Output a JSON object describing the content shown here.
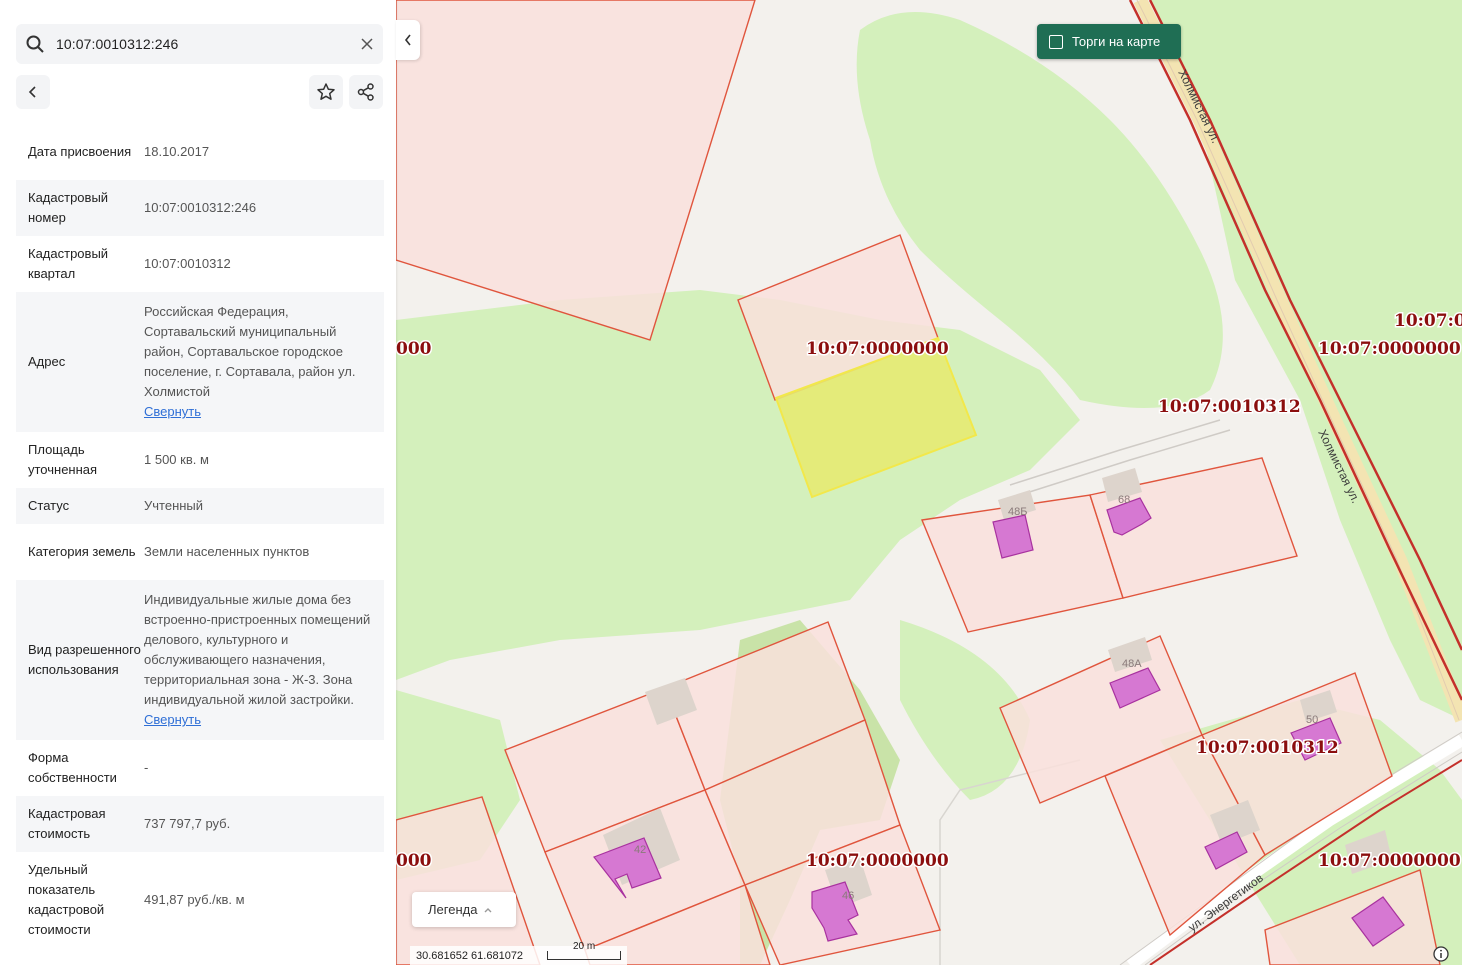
{
  "search": {
    "value": "10:07:0010312:246"
  },
  "attributes": [
    {
      "label": "Дата присвоения",
      "value": "18.10.2017"
    },
    {
      "label": "Кадастровый номер",
      "value": "10:07:0010312:246"
    },
    {
      "label": "Кадастровый квартал",
      "value": "10:07:0010312"
    },
    {
      "label": "Адрес",
      "value": "Российская Федерация, Сортавальский муниципальный район, Сортавальское городское поселение, г. Сортавала, район ул. Холмистой",
      "link": "Свернуть"
    },
    {
      "label": "Площадь уточненная",
      "value": "1 500 кв. м"
    },
    {
      "label": "Статус",
      "value": "Учтенный"
    },
    {
      "label": "Категория земель",
      "value": "Земли населенных пунктов"
    },
    {
      "label": "Вид разрешенного использования",
      "value": "Индивидуальные жилые дома без встроенно-пристроенных помещений делового, культурного и обслуживающего назначения, территориальная зона - Ж-3. Зона индивидуальной жилой застройки.",
      "link": "Свернуть"
    },
    {
      "label": "Форма собственности",
      "value": "-"
    },
    {
      "label": "Кадастровая стоимость",
      "value": "737 797,7 руб."
    },
    {
      "label": "Удельный показатель кадастровой стоимости",
      "value": "491,87 руб./кв. м"
    }
  ],
  "map": {
    "torgi_label": "Торги на карте",
    "legend_label": "Легенда",
    "coords": "30.681652  61.681072",
    "scale_label": "20 m",
    "cadastral_labels": {
      "l1": "000",
      "l2": "10:07:0000000",
      "l3": "10:07:0",
      "l4": "10:07:0000000",
      "l5": "10:07:0010312",
      "l6": "10:07:0010312",
      "l7": "000",
      "l8": "10:07:0000000",
      "l9": "10:07:0000000"
    },
    "house_numbers": {
      "h1": "48Б",
      "h2": "68",
      "h3": "48А",
      "h4": "50",
      "h5": "42",
      "h6": "46"
    },
    "streets": {
      "s1": "Холмистая ул.",
      "s2": "Холмистая ул.",
      "s3": "ул. Энергетиков"
    },
    "colors": {
      "parcel_fill": "#f9e0dc",
      "parcel_stroke": "#e0553d",
      "selected_fill": "#e6ea72",
      "green": "#d4f0bc",
      "building": "#d678d2",
      "torgi_bg": "#1f6e54",
      "label": "#8b0e0e"
    }
  }
}
